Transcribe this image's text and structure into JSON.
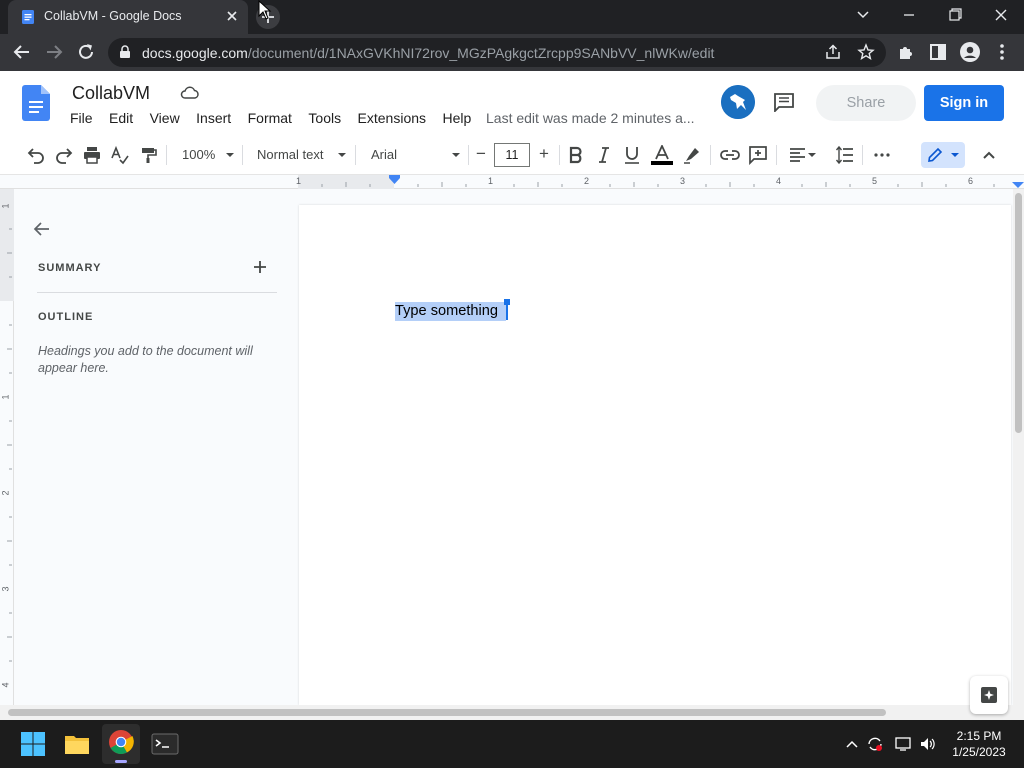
{
  "browser": {
    "tab_title": "CollabVM - Google Docs",
    "url_host": "docs.google.com",
    "url_path": "/document/d/1NAxGVKhNI72rov_MGzPAgkgctZrcpp9SANbVV_nlWKw/edit"
  },
  "docs": {
    "title": "CollabVM",
    "menu": [
      "File",
      "Edit",
      "View",
      "Insert",
      "Format",
      "Tools",
      "Extensions",
      "Help"
    ],
    "last_edit": "Last edit was made 2 minutes a...",
    "share_label": "Share",
    "signin_label": "Sign in",
    "accent": "#1a73e8"
  },
  "toolbar": {
    "zoom": "100%",
    "style": "Normal text",
    "font": "Arial",
    "font_size": "11",
    "minus": "−",
    "plus": "+"
  },
  "ruler": {
    "labels": [
      "1",
      "1",
      "2",
      "3",
      "4",
      "5",
      "6"
    ],
    "vlabels": [
      "1",
      "1",
      "2",
      "3",
      "4"
    ]
  },
  "outline": {
    "summary_label": "SUMMARY",
    "outline_label": "OUTLINE",
    "hint": "Headings you add to the document will appear here."
  },
  "document": {
    "text": "Type something"
  },
  "taskbar": {
    "time": "2:15 PM",
    "date": "1/25/2023"
  }
}
